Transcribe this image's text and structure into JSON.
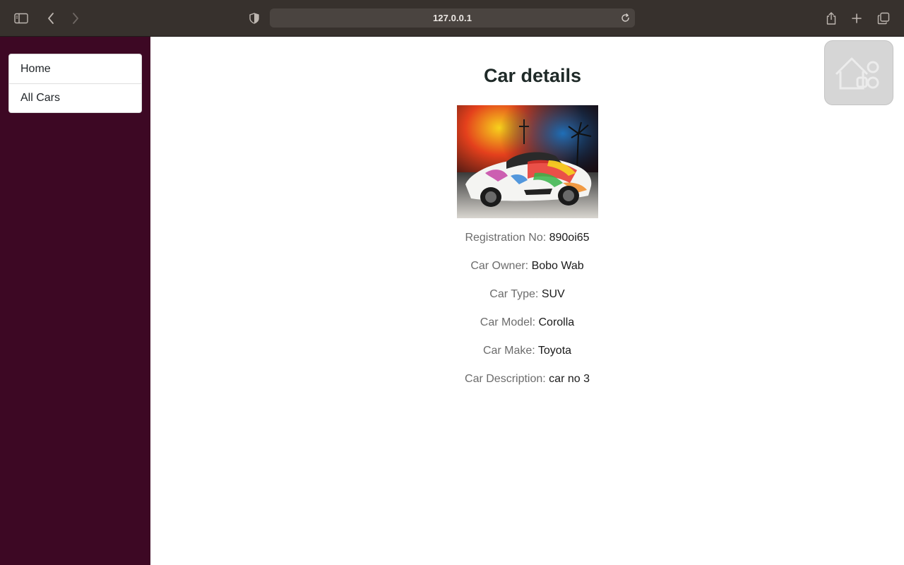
{
  "browser": {
    "url": "127.0.0.1",
    "icons": [
      "sidebar-toggle-icon",
      "back-icon",
      "forward-icon",
      "shield-icon",
      "reload-icon",
      "share-icon",
      "new-tab-icon",
      "tab-overview-icon"
    ]
  },
  "sidebar": {
    "items": [
      {
        "label": "Home"
      },
      {
        "label": "All Cars"
      }
    ]
  },
  "main": {
    "title": "Car details",
    "image_icon": "car-photo",
    "details": [
      {
        "label": "Registration No:",
        "value": "890oi65"
      },
      {
        "label": "Car Owner:",
        "value": "Bobo Wab"
      },
      {
        "label": "Car Type:",
        "value": "SUV"
      },
      {
        "label": "Car Model:",
        "value": "Corolla"
      },
      {
        "label": "Car Make:",
        "value": "Toyota"
      },
      {
        "label": "Car Description:",
        "value": "car no 3"
      }
    ]
  },
  "widget": {
    "icon": "home-shapes-icon"
  },
  "colors": {
    "sidebar_bg": "#3d0824",
    "toolbar_bg": "#37312d",
    "label_gray": "#6c6c6c"
  }
}
